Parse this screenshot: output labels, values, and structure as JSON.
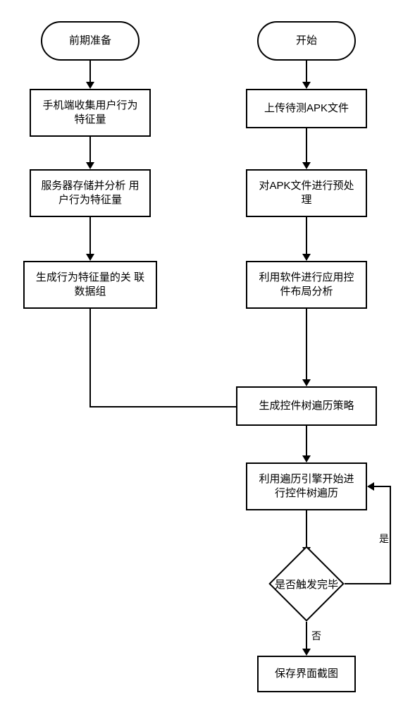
{
  "left": {
    "start": "前期准备",
    "step1": "手机端收集用户行为\n特征量",
    "step2": "服务器存储并分析\n用户行为特征量",
    "step3": "生成行为特征量的关\n联数据组"
  },
  "right": {
    "start": "开始",
    "step1": "上传待测APK文件",
    "step2": "对APK文件进行预处\n理",
    "step3": "利用软件进行应用控\n件布局分析",
    "step4": "生成控件树遍历策略",
    "step5": "利用遍历引擎开始进\n行控件树遍历",
    "decision": "是否触发完毕",
    "end": "保存界面截图"
  },
  "edges": {
    "yes": "是",
    "no": "否"
  },
  "chart_data": {
    "type": "flowchart",
    "lanes": [
      {
        "name": "preparation",
        "nodes": [
          {
            "id": "L0",
            "type": "terminal",
            "label": "前期准备"
          },
          {
            "id": "L1",
            "type": "process",
            "label": "手机端收集用户行为特征量"
          },
          {
            "id": "L2",
            "type": "process",
            "label": "服务器存储并分析用户行为特征量"
          },
          {
            "id": "L3",
            "type": "process",
            "label": "生成行为特征量的关联数据组"
          }
        ]
      },
      {
        "name": "main",
        "nodes": [
          {
            "id": "R0",
            "type": "terminal",
            "label": "开始"
          },
          {
            "id": "R1",
            "type": "process",
            "label": "上传待测APK文件"
          },
          {
            "id": "R2",
            "type": "process",
            "label": "对APK文件进行预处理"
          },
          {
            "id": "R3",
            "type": "process",
            "label": "利用软件进行应用控件布局分析"
          },
          {
            "id": "R4",
            "type": "process",
            "label": "生成控件树遍历策略"
          },
          {
            "id": "R5",
            "type": "process",
            "label": "利用遍历引擎开始进行控件树遍历"
          },
          {
            "id": "R6",
            "type": "decision",
            "label": "是否触发完毕"
          },
          {
            "id": "R7",
            "type": "process",
            "label": "保存界面截图"
          }
        ]
      }
    ],
    "edges": [
      {
        "from": "L0",
        "to": "L1"
      },
      {
        "from": "L1",
        "to": "L2"
      },
      {
        "from": "L2",
        "to": "L3"
      },
      {
        "from": "L3",
        "to": "R4"
      },
      {
        "from": "R0",
        "to": "R1"
      },
      {
        "from": "R1",
        "to": "R2"
      },
      {
        "from": "R2",
        "to": "R3"
      },
      {
        "from": "R3",
        "to": "R4"
      },
      {
        "from": "R4",
        "to": "R5"
      },
      {
        "from": "R5",
        "to": "R6"
      },
      {
        "from": "R6",
        "to": "R5",
        "label": "是"
      },
      {
        "from": "R6",
        "to": "R7",
        "label": "否"
      }
    ]
  }
}
